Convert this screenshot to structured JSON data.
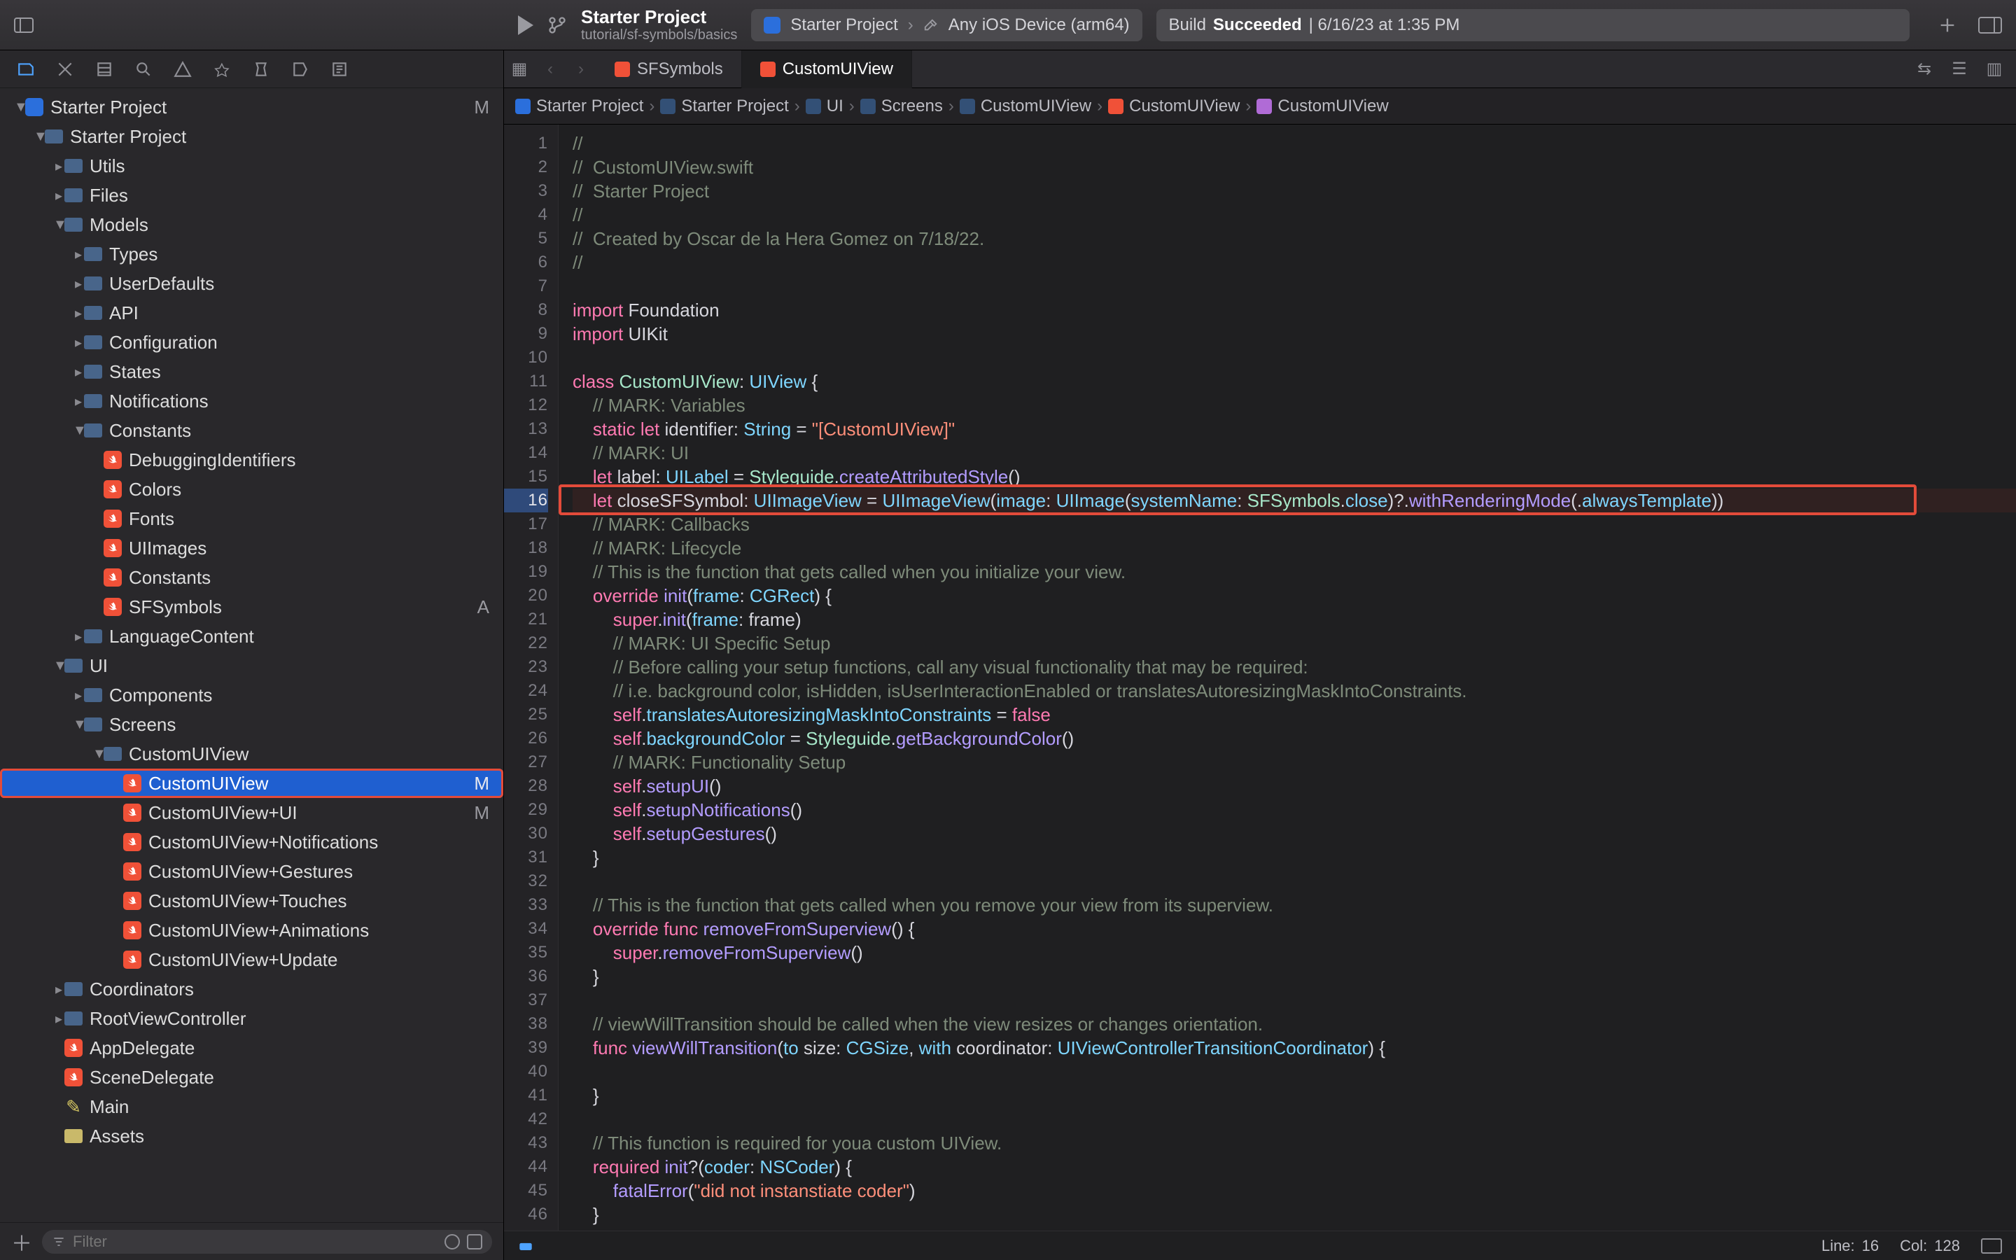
{
  "titlebar": {
    "project_name": "Starter Project",
    "subtitle": "tutorial/sf-symbols/basics",
    "scheme": "Starter Project",
    "destination": "Any iOS Device (arm64)",
    "status_prefix": "Build",
    "status_result": "Succeeded",
    "status_time": "| 6/16/23 at 1:35 PM"
  },
  "tabs": [
    {
      "label": "SFSymbols",
      "active": false
    },
    {
      "label": "CustomUIView",
      "active": true
    }
  ],
  "jumpbar": [
    {
      "icon": "proj",
      "label": "Starter Project"
    },
    {
      "icon": "fold",
      "label": "Starter Project"
    },
    {
      "icon": "fold",
      "label": "UI"
    },
    {
      "icon": "fold",
      "label": "Screens"
    },
    {
      "icon": "fold",
      "label": "CustomUIView"
    },
    {
      "icon": "sw",
      "label": "CustomUIView"
    },
    {
      "icon": "cls",
      "label": "CustomUIView"
    }
  ],
  "sidebar": {
    "filter_placeholder": "Filter",
    "items": [
      {
        "d": 0,
        "kind": "proj",
        "label": "Starter Project",
        "open": true,
        "badge": "M"
      },
      {
        "d": 1,
        "kind": "fold",
        "label": "Starter Project",
        "open": true
      },
      {
        "d": 2,
        "kind": "fold",
        "label": "Utils"
      },
      {
        "d": 2,
        "kind": "fold",
        "label": "Files"
      },
      {
        "d": 2,
        "kind": "fold",
        "label": "Models",
        "open": true
      },
      {
        "d": 3,
        "kind": "fold",
        "label": "Types"
      },
      {
        "d": 3,
        "kind": "fold",
        "label": "UserDefaults"
      },
      {
        "d": 3,
        "kind": "fold",
        "label": "API"
      },
      {
        "d": 3,
        "kind": "fold",
        "label": "Configuration"
      },
      {
        "d": 3,
        "kind": "fold",
        "label": "States"
      },
      {
        "d": 3,
        "kind": "fold",
        "label": "Notifications"
      },
      {
        "d": 3,
        "kind": "fold",
        "label": "Constants",
        "open": true
      },
      {
        "d": 4,
        "kind": "swift",
        "label": "DebuggingIdentifiers"
      },
      {
        "d": 4,
        "kind": "swift",
        "label": "Colors"
      },
      {
        "d": 4,
        "kind": "swift",
        "label": "Fonts"
      },
      {
        "d": 4,
        "kind": "swift",
        "label": "UIImages"
      },
      {
        "d": 4,
        "kind": "swift",
        "label": "Constants"
      },
      {
        "d": 4,
        "kind": "swift",
        "label": "SFSymbols",
        "badge": "A"
      },
      {
        "d": 3,
        "kind": "fold",
        "label": "LanguageContent"
      },
      {
        "d": 2,
        "kind": "fold",
        "label": "UI",
        "open": true
      },
      {
        "d": 3,
        "kind": "fold",
        "label": "Components"
      },
      {
        "d": 3,
        "kind": "fold",
        "label": "Screens",
        "open": true
      },
      {
        "d": 4,
        "kind": "fold",
        "label": "CustomUIView",
        "open": true
      },
      {
        "d": 5,
        "kind": "swift",
        "label": "CustomUIView",
        "badge": "M",
        "selected": true,
        "outlined": true
      },
      {
        "d": 5,
        "kind": "swift",
        "label": "CustomUIView+UI",
        "badge": "M"
      },
      {
        "d": 5,
        "kind": "swift",
        "label": "CustomUIView+Notifications"
      },
      {
        "d": 5,
        "kind": "swift",
        "label": "CustomUIView+Gestures"
      },
      {
        "d": 5,
        "kind": "swift",
        "label": "CustomUIView+Touches"
      },
      {
        "d": 5,
        "kind": "swift",
        "label": "CustomUIView+Animations"
      },
      {
        "d": 5,
        "kind": "swift",
        "label": "CustomUIView+Update"
      },
      {
        "d": 2,
        "kind": "fold",
        "label": "Coordinators"
      },
      {
        "d": 2,
        "kind": "fold",
        "label": "RootViewController"
      },
      {
        "d": 2,
        "kind": "swift",
        "label": "AppDelegate"
      },
      {
        "d": 2,
        "kind": "swift",
        "label": "SceneDelegate"
      },
      {
        "d": 2,
        "kind": "pencil",
        "label": "Main"
      },
      {
        "d": 2,
        "kind": "assets",
        "label": "Assets"
      }
    ]
  },
  "code": {
    "current_line": 16,
    "highlight_line": 16,
    "lines": [
      {
        "n": 1,
        "t": "cmt",
        "s": "//"
      },
      {
        "n": 2,
        "t": "cmt",
        "s": "//  CustomUIView.swift"
      },
      {
        "n": 3,
        "t": "cmt",
        "s": "//  Starter Project"
      },
      {
        "n": 4,
        "t": "cmt",
        "s": "//"
      },
      {
        "n": 5,
        "t": "cmt",
        "s": "//  Created by Oscar de la Hera Gomez on 7/18/22."
      },
      {
        "n": 6,
        "t": "cmt",
        "s": "//"
      },
      {
        "n": 7,
        "t": "plain",
        "s": ""
      },
      {
        "n": 8,
        "t": "mix",
        "seg": [
          [
            "kw",
            "import "
          ],
          [
            "plain",
            "Foundation"
          ]
        ]
      },
      {
        "n": 9,
        "t": "mix",
        "seg": [
          [
            "kw",
            "import "
          ],
          [
            "plain",
            "UIKit"
          ]
        ]
      },
      {
        "n": 10,
        "t": "plain",
        "s": ""
      },
      {
        "n": 11,
        "t": "mix",
        "seg": [
          [
            "kw",
            "class "
          ],
          [
            "type2",
            "CustomUIView"
          ],
          [
            "plain",
            ": "
          ],
          [
            "type",
            "UIView"
          ],
          [
            "plain",
            " {"
          ]
        ]
      },
      {
        "n": 12,
        "t": "mix",
        "seg": [
          [
            "plain",
            "    "
          ],
          [
            "cmt",
            "// MARK: Variables"
          ]
        ]
      },
      {
        "n": 13,
        "t": "mix",
        "seg": [
          [
            "plain",
            "    "
          ],
          [
            "kw",
            "static let "
          ],
          [
            "plain",
            "identifier: "
          ],
          [
            "type",
            "String"
          ],
          [
            "plain",
            " = "
          ],
          [
            "str",
            "\"[CustomUIView]\""
          ]
        ]
      },
      {
        "n": 14,
        "t": "mix",
        "seg": [
          [
            "plain",
            "    "
          ],
          [
            "cmt",
            "// MARK: UI"
          ]
        ]
      },
      {
        "n": 15,
        "t": "mix",
        "seg": [
          [
            "plain",
            "    "
          ],
          [
            "kw",
            "let "
          ],
          [
            "plain",
            "label: "
          ],
          [
            "type",
            "UILabel"
          ],
          [
            "plain",
            " = "
          ],
          [
            "type2",
            "Styleguide"
          ],
          [
            "plain",
            "."
          ],
          [
            "func",
            "createAttributedStyle"
          ],
          [
            "plain",
            "()"
          ]
        ]
      },
      {
        "n": 16,
        "t": "mix",
        "seg": [
          [
            "plain",
            "    "
          ],
          [
            "kw",
            "let "
          ],
          [
            "plain",
            "closeSFSymbol: "
          ],
          [
            "type",
            "UIImageView"
          ],
          [
            "plain",
            " = "
          ],
          [
            "type",
            "UIImageView"
          ],
          [
            "plain",
            "("
          ],
          [
            "arg",
            "image"
          ],
          [
            "plain",
            ": "
          ],
          [
            "type",
            "UIImage"
          ],
          [
            "plain",
            "("
          ],
          [
            "arg",
            "systemName"
          ],
          [
            "plain",
            ": "
          ],
          [
            "type2",
            "SFSymbols"
          ],
          [
            "plain",
            "."
          ],
          [
            "prop",
            "close"
          ],
          [
            "plain",
            ")?."
          ],
          [
            "func",
            "withRenderingMode"
          ],
          [
            "plain",
            "(."
          ],
          [
            "prop",
            "alwaysTemplate"
          ],
          [
            "plain",
            "))"
          ]
        ]
      },
      {
        "n": 17,
        "t": "mix",
        "seg": [
          [
            "plain",
            "    "
          ],
          [
            "cmt",
            "// MARK: Callbacks"
          ]
        ]
      },
      {
        "n": 18,
        "t": "mix",
        "seg": [
          [
            "plain",
            "    "
          ],
          [
            "cmt",
            "// MARK: Lifecycle"
          ]
        ]
      },
      {
        "n": 19,
        "t": "mix",
        "seg": [
          [
            "plain",
            "    "
          ],
          [
            "cmt",
            "// This is the function that gets called when you initialize your view."
          ]
        ]
      },
      {
        "n": 20,
        "t": "mix",
        "seg": [
          [
            "plain",
            "    "
          ],
          [
            "kw",
            "override "
          ],
          [
            "func",
            "init"
          ],
          [
            "plain",
            "("
          ],
          [
            "arg",
            "frame"
          ],
          [
            "plain",
            ": "
          ],
          [
            "type",
            "CGRect"
          ],
          [
            "plain",
            ") {"
          ]
        ]
      },
      {
        "n": 21,
        "t": "mix",
        "seg": [
          [
            "plain",
            "        "
          ],
          [
            "kw",
            "super"
          ],
          [
            "plain",
            "."
          ],
          [
            "func",
            "init"
          ],
          [
            "plain",
            "("
          ],
          [
            "arg",
            "frame"
          ],
          [
            "plain",
            ": frame)"
          ]
        ]
      },
      {
        "n": 22,
        "t": "mix",
        "seg": [
          [
            "plain",
            "        "
          ],
          [
            "cmt",
            "// MARK: UI Specific Setup"
          ]
        ]
      },
      {
        "n": 23,
        "t": "mix",
        "seg": [
          [
            "plain",
            "        "
          ],
          [
            "cmt",
            "// Before calling your setup functions, call any visual functionality that may be required:"
          ]
        ]
      },
      {
        "n": 24,
        "t": "mix",
        "seg": [
          [
            "plain",
            "        "
          ],
          [
            "cmt",
            "// i.e. background color, isHidden, isUserInteractionEnabled or translatesAutoresizingMaskIntoConstraints."
          ]
        ]
      },
      {
        "n": 25,
        "t": "mix",
        "seg": [
          [
            "plain",
            "        "
          ],
          [
            "kw",
            "self"
          ],
          [
            "plain",
            "."
          ],
          [
            "prop",
            "translatesAutoresizingMaskIntoConstraints"
          ],
          [
            "plain",
            " = "
          ],
          [
            "kw",
            "false"
          ]
        ]
      },
      {
        "n": 26,
        "t": "mix",
        "seg": [
          [
            "plain",
            "        "
          ],
          [
            "kw",
            "self"
          ],
          [
            "plain",
            "."
          ],
          [
            "prop",
            "backgroundColor"
          ],
          [
            "plain",
            " = "
          ],
          [
            "type2",
            "Styleguide"
          ],
          [
            "plain",
            "."
          ],
          [
            "func",
            "getBackgroundColor"
          ],
          [
            "plain",
            "()"
          ]
        ]
      },
      {
        "n": 27,
        "t": "mix",
        "seg": [
          [
            "plain",
            "        "
          ],
          [
            "cmt",
            "// MARK: Functionality Setup"
          ]
        ]
      },
      {
        "n": 28,
        "t": "mix",
        "seg": [
          [
            "plain",
            "        "
          ],
          [
            "kw",
            "self"
          ],
          [
            "plain",
            "."
          ],
          [
            "func",
            "setupUI"
          ],
          [
            "plain",
            "()"
          ]
        ]
      },
      {
        "n": 29,
        "t": "mix",
        "seg": [
          [
            "plain",
            "        "
          ],
          [
            "kw",
            "self"
          ],
          [
            "plain",
            "."
          ],
          [
            "func",
            "setupNotifications"
          ],
          [
            "plain",
            "()"
          ]
        ]
      },
      {
        "n": 30,
        "t": "mix",
        "seg": [
          [
            "plain",
            "        "
          ],
          [
            "kw",
            "self"
          ],
          [
            "plain",
            "."
          ],
          [
            "func",
            "setupGestures"
          ],
          [
            "plain",
            "()"
          ]
        ]
      },
      {
        "n": 31,
        "t": "plain",
        "s": "    }"
      },
      {
        "n": 32,
        "t": "plain",
        "s": ""
      },
      {
        "n": 33,
        "t": "mix",
        "seg": [
          [
            "plain",
            "    "
          ],
          [
            "cmt",
            "// This is the function that gets called when you remove your view from its superview."
          ]
        ]
      },
      {
        "n": 34,
        "t": "mix",
        "seg": [
          [
            "plain",
            "    "
          ],
          [
            "kw",
            "override func "
          ],
          [
            "func",
            "removeFromSuperview"
          ],
          [
            "plain",
            "() {"
          ]
        ]
      },
      {
        "n": 35,
        "t": "mix",
        "seg": [
          [
            "plain",
            "        "
          ],
          [
            "kw",
            "super"
          ],
          [
            "plain",
            "."
          ],
          [
            "func",
            "removeFromSuperview"
          ],
          [
            "plain",
            "()"
          ]
        ]
      },
      {
        "n": 36,
        "t": "plain",
        "s": "    }"
      },
      {
        "n": 37,
        "t": "plain",
        "s": ""
      },
      {
        "n": 38,
        "t": "mix",
        "seg": [
          [
            "plain",
            "    "
          ],
          [
            "cmt",
            "// viewWillTransition should be called when the view resizes or changes orientation."
          ]
        ]
      },
      {
        "n": 39,
        "t": "mix",
        "seg": [
          [
            "plain",
            "    "
          ],
          [
            "kw",
            "func "
          ],
          [
            "func",
            "viewWillTransition"
          ],
          [
            "plain",
            "("
          ],
          [
            "arg",
            "to"
          ],
          [
            "plain",
            " size: "
          ],
          [
            "type",
            "CGSize"
          ],
          [
            "plain",
            ", "
          ],
          [
            "arg",
            "with"
          ],
          [
            "plain",
            " coordinator: "
          ],
          [
            "type",
            "UIViewControllerTransitionCoordinator"
          ],
          [
            "plain",
            ") {"
          ]
        ]
      },
      {
        "n": 40,
        "t": "plain",
        "s": ""
      },
      {
        "n": 41,
        "t": "plain",
        "s": "    }"
      },
      {
        "n": 42,
        "t": "plain",
        "s": ""
      },
      {
        "n": 43,
        "t": "mix",
        "seg": [
          [
            "plain",
            "    "
          ],
          [
            "cmt",
            "// This function is required for youa custom UIView."
          ]
        ]
      },
      {
        "n": 44,
        "t": "mix",
        "seg": [
          [
            "plain",
            "    "
          ],
          [
            "kw",
            "required "
          ],
          [
            "func",
            "init"
          ],
          [
            "plain",
            "?("
          ],
          [
            "arg",
            "coder"
          ],
          [
            "plain",
            ": "
          ],
          [
            "type",
            "NSCoder"
          ],
          [
            "plain",
            ") {"
          ]
        ]
      },
      {
        "n": 45,
        "t": "mix",
        "seg": [
          [
            "plain",
            "        "
          ],
          [
            "func",
            "fatalError"
          ],
          [
            "plain",
            "("
          ],
          [
            "str",
            "\"did not instanstiate coder\""
          ],
          [
            "plain",
            ")"
          ]
        ]
      },
      {
        "n": 46,
        "t": "plain",
        "s": "    }"
      }
    ]
  },
  "statusbar": {
    "line_label": "Line:",
    "line": "16",
    "col_label": "Col:",
    "col": "128"
  }
}
